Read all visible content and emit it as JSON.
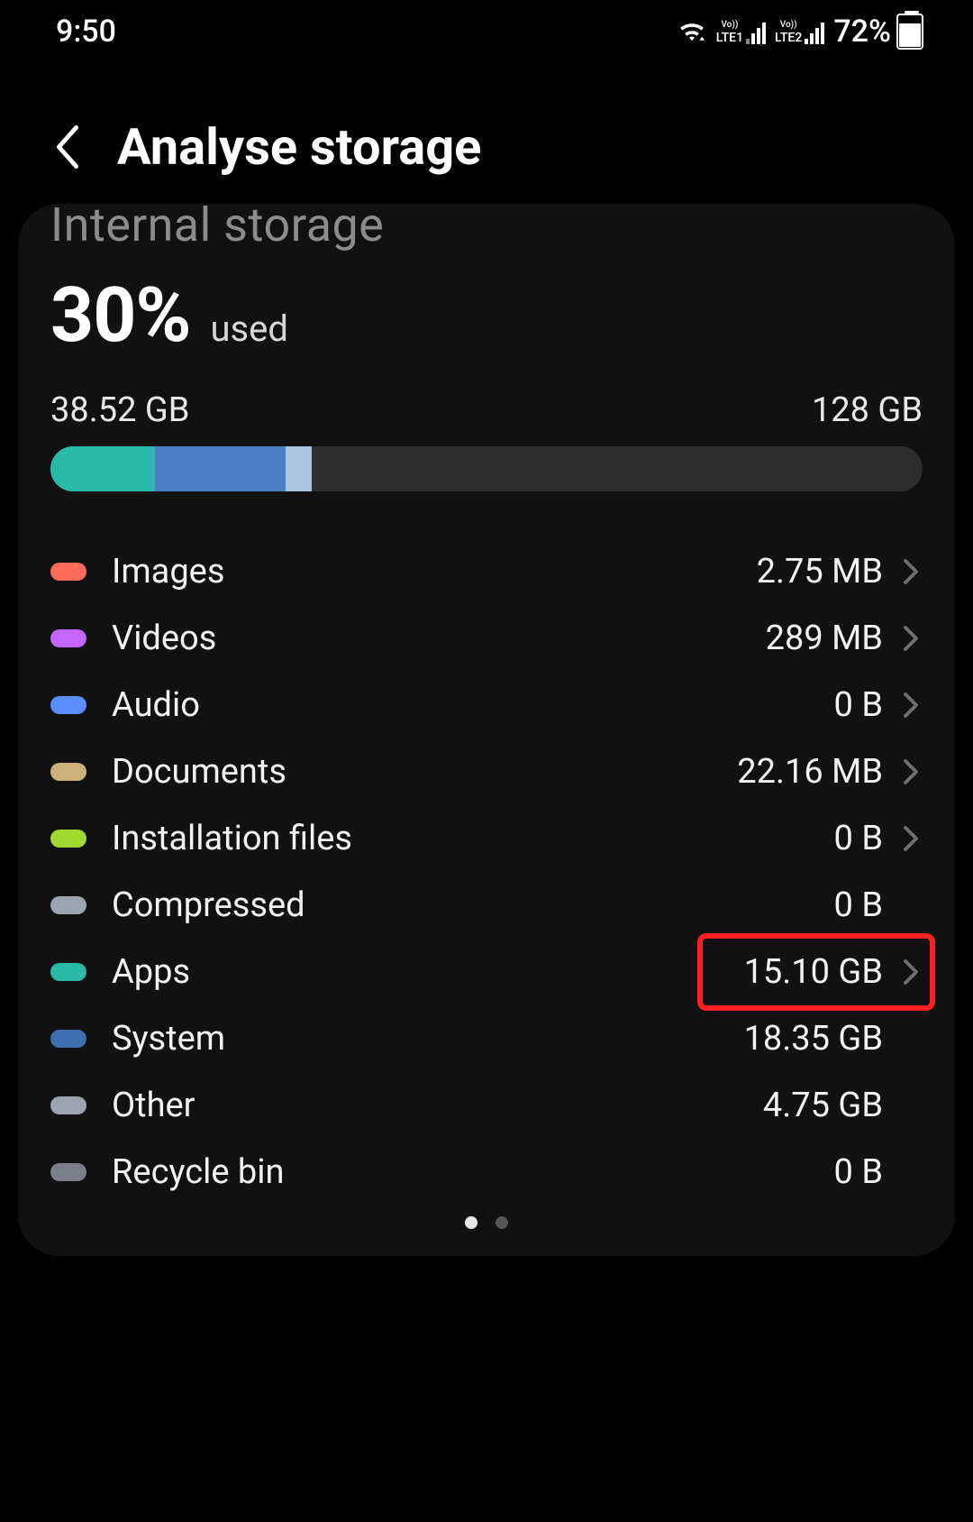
{
  "status_bar": {
    "time": "9:50",
    "sim1_label": "LTE1",
    "sim2_label": "LTE2",
    "battery_text": "72%",
    "battery_level": 72
  },
  "header": {
    "title": "Analyse storage"
  },
  "storage": {
    "heading": "Internal storage",
    "percent": "30%",
    "used_label": "used",
    "used_amount": "38.52 GB",
    "total_amount": "128 GB",
    "bar_segments": [
      {
        "name": "apps-seg",
        "color": "#2ab8a8",
        "width_pct": 12
      },
      {
        "name": "system-seg",
        "color": "#4b7ec4",
        "width_pct": 15
      },
      {
        "name": "other-seg",
        "color": "#a9c4de",
        "width_pct": 3
      }
    ],
    "categories": [
      {
        "label": "Images",
        "size": "2.75 MB",
        "color": "#ff6b5b",
        "chevron": true,
        "highlight": false
      },
      {
        "label": "Videos",
        "size": "289 MB",
        "color": "#c566ff",
        "chevron": true,
        "highlight": false
      },
      {
        "label": "Audio",
        "size": "0 B",
        "color": "#5b8dff",
        "chevron": true,
        "highlight": false
      },
      {
        "label": "Documents",
        "size": "22.16 MB",
        "color": "#cbb07a",
        "chevron": true,
        "highlight": false
      },
      {
        "label": "Installation files",
        "size": "0 B",
        "color": "#a1d933",
        "chevron": true,
        "highlight": false
      },
      {
        "label": "Compressed",
        "size": "0 B",
        "color": "#9aa5b1",
        "chevron": false,
        "highlight": false
      },
      {
        "label": "Apps",
        "size": "15.10 GB",
        "color": "#2ab8a8",
        "chevron": true,
        "highlight": true
      },
      {
        "label": "System",
        "size": "18.35 GB",
        "color": "#3f6fb0",
        "chevron": false,
        "highlight": false
      },
      {
        "label": "Other",
        "size": "4.75 GB",
        "color": "#9aa5b1",
        "chevron": false,
        "highlight": false
      },
      {
        "label": "Recycle bin",
        "size": "0 B",
        "color": "#7c808a",
        "chevron": false,
        "highlight": false
      }
    ]
  },
  "pager": {
    "count": 2,
    "active_index": 0
  }
}
